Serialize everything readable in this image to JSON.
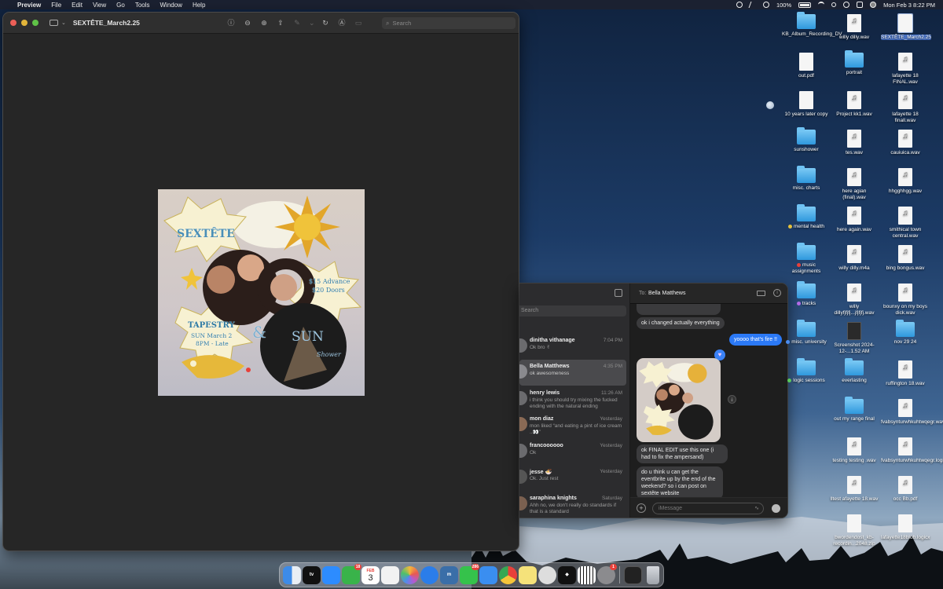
{
  "menubar": {
    "app": "Preview",
    "items": [
      "File",
      "Edit",
      "View",
      "Go",
      "Tools",
      "Window",
      "Help"
    ],
    "battery": "100%",
    "clock": "Mon Feb 3  8:22 PM"
  },
  "preview": {
    "title": "SEXTÊTE_March2.25",
    "search_placeholder": "Search"
  },
  "poster": {
    "band": "SEXTÊTE",
    "price_advance": "$15 Advance",
    "price_doors": "$20 Doors",
    "venue": "TAPESTRY",
    "date": "SUN March 2",
    "time": "8PM - Late",
    "ampersand": "&",
    "support_1": "SUN",
    "support_2": "Shower"
  },
  "messages": {
    "search_placeholder": "Search",
    "to_label": "To:",
    "recipient": "Bella Matthews",
    "conversations": [
      {
        "name": "dinitha vithanage",
        "time": "7:04 PM",
        "preview": "Ok bro ✌"
      },
      {
        "name": "Bella Matthews",
        "time": "4:35 PM",
        "preview": "ok awesomeness"
      },
      {
        "name": "henry lewis",
        "time": "11:26 AM",
        "preview": "i think you should try mixing the fucked ending with the natural ending"
      },
      {
        "name": "mon diaz",
        "time": "Yesterday",
        "preview": "mon liked “and eating a pint of ice cream ..👀”"
      },
      {
        "name": "francoooooo",
        "time": "Yesterday",
        "preview": "Ok"
      },
      {
        "name": "jesse 🍜",
        "time": "Yesterday",
        "preview": "Ok. Just rest"
      },
      {
        "name": "saraphina knights",
        "time": "Saturday",
        "preview": "Ahh no, we don't really do standards if that is a standard"
      }
    ],
    "bubbles": {
      "m1": "ok i changed actually everything",
      "m2": "yoooo that's fire !!",
      "m3": "ok FINAL EDIT use this one (i had to fix the ampersand)",
      "m4": "do u think u can get the eventbrite up by the end of the weekend? so i can post on sextête website"
    },
    "input_placeholder": "iMessage"
  },
  "desktop": {
    "icons": [
      {
        "label": "KB_Album_Recording_DV"
      },
      {
        "label": "willy dilly.wav"
      },
      {
        "label": "SEXTÊTE_March2.25"
      },
      {
        "label": "out.pdf"
      },
      {
        "label": "portrait"
      },
      {
        "label": "lafayette 18 FINAL.wav"
      },
      {
        "label": "10 years later copy"
      },
      {
        "label": "Project kk1.wav"
      },
      {
        "label": "lafayette 18 finall.wav"
      },
      {
        "label": "sunshower"
      },
      {
        "label": "tes.wav"
      },
      {
        "label": "cauiuica.wav"
      },
      {
        "label": "misc. charts"
      },
      {
        "label": "here agian (final).wav"
      },
      {
        "label": "hhgghhgg.wav"
      },
      {
        "label": "mental health"
      },
      {
        "label": "here again.wav"
      },
      {
        "label": "smithical town central.wav"
      },
      {
        "label": "music assignments"
      },
      {
        "label": "willy dilly.m4a"
      },
      {
        "label": "bing bongus.wav"
      },
      {
        "label": "tracks"
      },
      {
        "label": "willy dillyfjfjfj...jfjfjfj.wav"
      },
      {
        "label": "bounxy on my boys dick.wav"
      },
      {
        "label": "misc. university"
      },
      {
        "label": "Screenshot 2024-12-...1.52 AM"
      },
      {
        "label": "nov 29 24"
      },
      {
        "label": "logic sessions"
      },
      {
        "label": "everlasting"
      },
      {
        "label": "ruffington 18.wav"
      },
      {
        "label": "out my range final"
      },
      {
        "label": "fvabsynturwhkuhtwqegr.wav"
      },
      {
        "label": "testing testing .wav"
      },
      {
        "label": "fvabsynturwhkuhtwqegr.logicx"
      },
      {
        "label": "lltest afayette 18.wav"
      },
      {
        "label": "occ Bb.pdf"
      },
      {
        "label": "bwordendost_kb-recordin...2048.zip"
      },
      {
        "label": "lafayette18blob.logicx"
      }
    ]
  },
  "dock": {
    "calendar_month": "FEB",
    "calendar_day": "3",
    "apps": [
      "finder-icon",
      "apple-tv-icon",
      "zoom-icon",
      "facetime-icon",
      "calendar-icon",
      "notes-icon",
      "photos-icon",
      "safari-icon",
      "muse-icon",
      "messages-icon",
      "mail-icon",
      "chrome-icon",
      "notes-icon",
      "spotify-icon",
      "tidal-icon",
      "piano-icon",
      "settings-icon"
    ],
    "badges": {
      "facetime": "18",
      "messages": "286",
      "settings": "1"
    }
  },
  "colors": {
    "imessage_blue": "#2b79f6",
    "folder_blue": "#2f98dd",
    "tag_yellow": "#e6c13b",
    "tag_red": "#e8403a",
    "tag_purple": "#b36be6",
    "tag_blue": "#4b8df0",
    "tag_green": "#5ac85a"
  }
}
